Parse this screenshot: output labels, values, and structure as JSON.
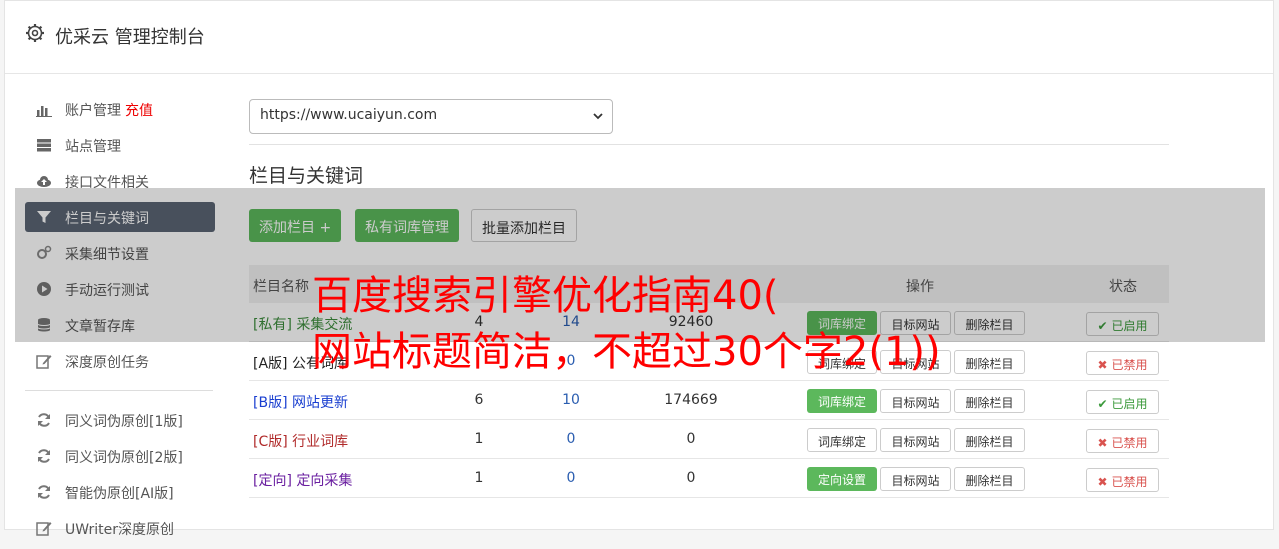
{
  "app": {
    "title": "优采云 管理控制台"
  },
  "sidebar": {
    "items": [
      {
        "label": "账户管理",
        "extra": "充值",
        "icon": "bar-chart-icon"
      },
      {
        "label": "站点管理",
        "icon": "server-icon"
      },
      {
        "label": "接口文件相关",
        "icon": "cloud-upload-icon"
      },
      {
        "label": "栏目与关键词",
        "icon": "filter-icon",
        "active": true
      },
      {
        "label": "采集细节设置",
        "icon": "cogs-icon"
      },
      {
        "label": "手动运行测试",
        "icon": "play-circle-icon"
      },
      {
        "label": "文章暂存库",
        "icon": "database-icon"
      },
      {
        "label": "深度原创任务",
        "icon": "edit-icon"
      }
    ],
    "items2": [
      {
        "label": "同义词伪原创[1版]",
        "icon": "refresh-icon"
      },
      {
        "label": "同义词伪原创[2版]",
        "icon": "refresh-icon"
      },
      {
        "label": "智能伪原创[AI版]",
        "icon": "refresh-icon"
      },
      {
        "label": "UWriter深度原创",
        "icon": "edit-icon"
      }
    ]
  },
  "site_select": {
    "value": "https://www.ucaiyun.com"
  },
  "section": {
    "title": "栏目与关键词"
  },
  "toolbar": {
    "add_column": "添加栏目 +",
    "private_lib": "私有词库管理",
    "batch_add": "批量添加栏目"
  },
  "table": {
    "headers": {
      "name": "栏目名称",
      "ops": "操作",
      "status": "状态"
    },
    "rows": [
      {
        "tag": "[私有]",
        "name": "采集交流",
        "n1": "4",
        "n2": "14",
        "n3": "92460",
        "op1": "词库绑定",
        "op1_green": true,
        "op2": "目标网站",
        "op3": "删除栏目",
        "status": "已启用",
        "on": true,
        "color": "#3c8c3c"
      },
      {
        "tag": "[A版]",
        "name": "公有词库",
        "n1": "",
        "n2": "0",
        "n3": "",
        "op1": "词库绑定",
        "op1_green": false,
        "op2": "目标网站",
        "op3": "删除栏目",
        "status": "已禁用",
        "on": false,
        "color": "#222"
      },
      {
        "tag": "[B版]",
        "name": "网站更新",
        "n1": "6",
        "n2": "10",
        "n3": "174669",
        "op1": "词库绑定",
        "op1_green": true,
        "op2": "目标网站",
        "op3": "删除栏目",
        "status": "已启用",
        "on": true,
        "color": "#1a3fd0"
      },
      {
        "tag": "[C版]",
        "name": "行业词库",
        "n1": "1",
        "n2": "0",
        "n3": "0",
        "op1": "词库绑定",
        "op1_green": false,
        "op2": "目标网站",
        "op3": "删除栏目",
        "status": "已禁用",
        "on": false,
        "color": "#b02a2a"
      },
      {
        "tag": "[定向]",
        "name": "定向采集",
        "n1": "1",
        "n2": "0",
        "n3": "0",
        "op1": "定向设置",
        "op1_green": true,
        "op2": "目标网站",
        "op3": "删除栏目",
        "status": "已禁用",
        "on": false,
        "color": "#6a1fa0"
      }
    ]
  },
  "overlay": {
    "line1": "百度搜索引擎优化指南40(",
    "line2": "网站标题简洁，不超过30个字2(1))"
  },
  "colors": {
    "accent_green": "#5cb85c",
    "active_nav": "#5b6574",
    "watermark_red": "#ff0000"
  }
}
